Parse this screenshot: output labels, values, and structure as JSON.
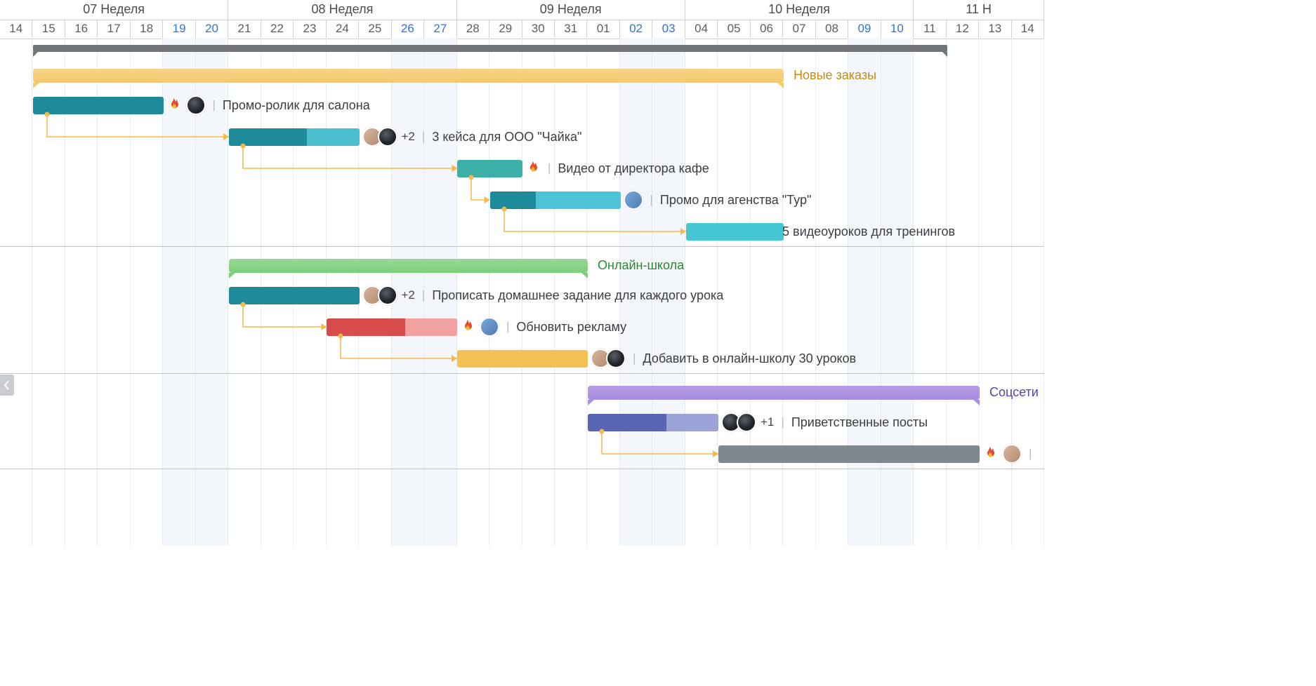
{
  "chart_data": {
    "type": "gantt",
    "unit": "day",
    "weeks": [
      {
        "label": "07 Неделя",
        "span_days": 7,
        "start_index": 0
      },
      {
        "label": "08 Неделя",
        "span_days": 7,
        "start_index": 7
      },
      {
        "label": "09 Неделя",
        "span_days": 7,
        "start_index": 14
      },
      {
        "label": "10 Неделя",
        "span_days": 7,
        "start_index": 21
      },
      {
        "label": "11 Н",
        "span_days": 4,
        "start_index": 28
      }
    ],
    "days": [
      {
        "n": "14",
        "weekend": false
      },
      {
        "n": "15",
        "weekend": false
      },
      {
        "n": "16",
        "weekend": false
      },
      {
        "n": "17",
        "weekend": false
      },
      {
        "n": "18",
        "weekend": false
      },
      {
        "n": "19",
        "weekend": true
      },
      {
        "n": "20",
        "weekend": true
      },
      {
        "n": "21",
        "weekend": false
      },
      {
        "n": "22",
        "weekend": false
      },
      {
        "n": "23",
        "weekend": false
      },
      {
        "n": "24",
        "weekend": false
      },
      {
        "n": "25",
        "weekend": false
      },
      {
        "n": "26",
        "weekend": true
      },
      {
        "n": "27",
        "weekend": true
      },
      {
        "n": "28",
        "weekend": false
      },
      {
        "n": "29",
        "weekend": false
      },
      {
        "n": "30",
        "weekend": false
      },
      {
        "n": "31",
        "weekend": false
      },
      {
        "n": "01",
        "weekend": false
      },
      {
        "n": "02",
        "weekend": true
      },
      {
        "n": "03",
        "weekend": true
      },
      {
        "n": "04",
        "weekend": false
      },
      {
        "n": "05",
        "weekend": false
      },
      {
        "n": "06",
        "weekend": false
      },
      {
        "n": "07",
        "weekend": false
      },
      {
        "n": "08",
        "weekend": false
      },
      {
        "n": "09",
        "weekend": true
      },
      {
        "n": "10",
        "weekend": true
      },
      {
        "n": "11",
        "weekend": false
      },
      {
        "n": "12",
        "weekend": false
      },
      {
        "n": "13",
        "weekend": false
      },
      {
        "n": "14",
        "weekend": false
      }
    ],
    "summary": {
      "start": 1,
      "end": 29
    },
    "groups": [
      {
        "id": "g1",
        "label": "Новые заказы",
        "color": "orange",
        "start": 1,
        "end": 24,
        "tasks": [
          {
            "id": "t1",
            "title": "Промо-ролик для салона",
            "start": 1,
            "end": 5,
            "progress": 1.0,
            "color": "#1f8a99",
            "flame": true,
            "avatars": [
              "c2"
            ]
          },
          {
            "id": "t2",
            "title": "3 кейса для ООО \"Чайка\"",
            "start": 7,
            "end": 11,
            "progress": 0.6,
            "color": "#1f8a99",
            "color_light": "#4bbfd0",
            "avatars": [
              "c1",
              "c2"
            ],
            "plus": "+2"
          },
          {
            "id": "t3",
            "title": "Видео от директора кафе",
            "start": 14,
            "end": 16,
            "progress": 1.0,
            "color": "#3cb0a6",
            "flame": true
          },
          {
            "id": "t4",
            "title": "Промо для агенства \"Тур\"",
            "start": 15,
            "end": 19,
            "progress": 0.35,
            "color": "#1f8a99",
            "color_light": "#4cc3d6",
            "avatars": [
              "c3"
            ]
          },
          {
            "id": "t5",
            "title": "5 видеоуроков для тренингов",
            "start": 21,
            "end": 24,
            "progress": 0,
            "color": "#46c6d3"
          }
        ]
      },
      {
        "id": "g2",
        "label": "Онлайн-школа",
        "color": "green",
        "start": 7,
        "end": 18,
        "tasks": [
          {
            "id": "t6",
            "title": "Прописать домашнее задание для каждого урока",
            "start": 7,
            "end": 11,
            "progress": 1.0,
            "color": "#1f8a99",
            "avatars": [
              "c1",
              "c2"
            ],
            "plus": "+2"
          },
          {
            "id": "t7",
            "title": "Обновить рекламу",
            "start": 10,
            "end": 14,
            "progress": 0.6,
            "color": "#d84b4b",
            "color_light": "#f2a1a1",
            "flame": true,
            "avatars": [
              "c3"
            ]
          },
          {
            "id": "t8",
            "title": "Добавить в онлайн-школу 30 уроков",
            "start": 14,
            "end": 18,
            "progress": 0,
            "color": "#f5c154",
            "avatars": [
              "c1",
              "c2"
            ]
          }
        ]
      },
      {
        "id": "g3",
        "label": "Соцсети",
        "color": "purple",
        "start": 18,
        "end": 30,
        "tasks": [
          {
            "id": "t9",
            "title": "Приветственные посты",
            "start": 18,
            "end": 22,
            "progress": 0.6,
            "color": "#5965b3",
            "color_light": "#9aa2d6",
            "avatars": [
              "c2",
              "c2"
            ],
            "plus": "+1"
          },
          {
            "id": "t10",
            "title": "",
            "start": 22,
            "end": 30,
            "progress": 1.0,
            "color": "#7e898f",
            "flame": true,
            "avatars": [
              "c1"
            ]
          }
        ]
      }
    ]
  }
}
